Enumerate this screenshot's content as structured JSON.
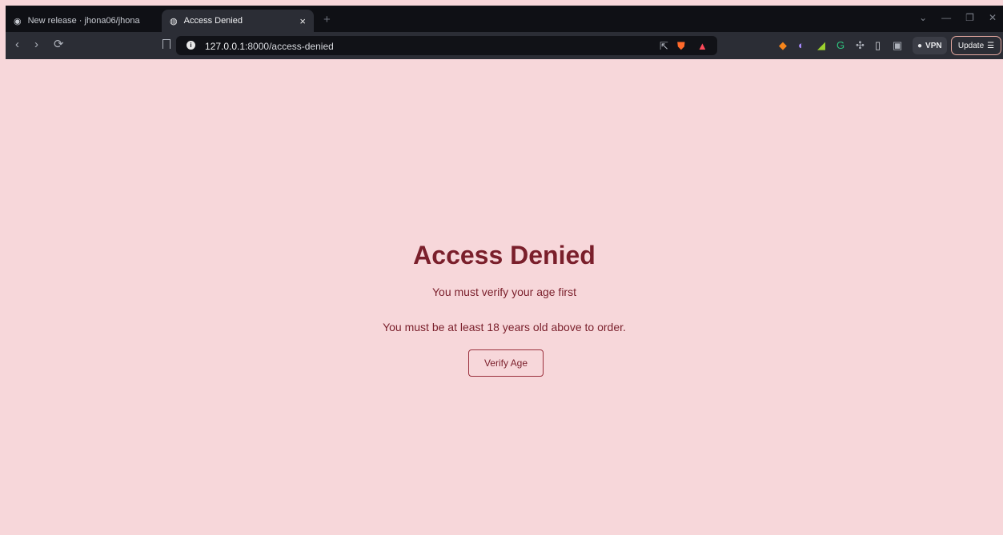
{
  "browser": {
    "tabs": [
      {
        "label": "New release · jhona06/jhona",
        "icon": "github-icon",
        "active": false
      },
      {
        "label": "Access Denied",
        "icon": "globe-icon",
        "active": true
      }
    ],
    "new_tab": "+",
    "url": {
      "host": "127.0.0.1",
      "rest": ":8000/access-denied"
    },
    "vpn_label": "VPN",
    "update_label": "Update"
  },
  "page": {
    "title": "Access Denied",
    "subtitle": "You must verify your age first",
    "message": "You must be at least 18 years old above to order.",
    "button": "Verify Age"
  },
  "colors": {
    "page_bg": "#f7d7da",
    "text": "#7a1f2b",
    "button_border": "#9a2f3c"
  }
}
